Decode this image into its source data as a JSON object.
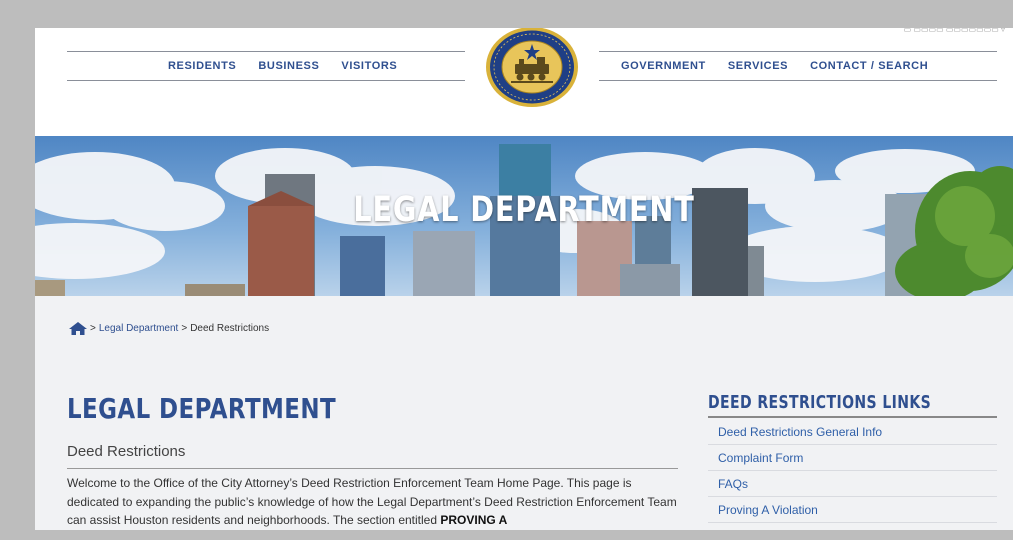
{
  "nav_left": [
    "RESIDENTS",
    "BUSINESS",
    "VISITORS"
  ],
  "nav_right": [
    "GOVERNMENT",
    "SERVICES",
    "CONTACT / SEARCH"
  ],
  "hero": {
    "title": "LEGAL DEPARTMENT"
  },
  "breadcrumb": {
    "sep1": ">",
    "link": "Legal Department",
    "sep2": ">",
    "current": "Deed Restrictions"
  },
  "main": {
    "heading": "LEGAL DEPARTMENT",
    "subheading": "Deed Restrictions",
    "intro_text": "Welcome to the Office of the City Attorney’s Deed Restriction Enforcement Team Home Page.  This page is dedicated to expanding the public’s knowledge of how the Legal Department’s Deed Restriction Enforcement Team can assist Houston residents and neighborhoods.  The section entitled ",
    "intro_bold": "PROVING A"
  },
  "sidebar": {
    "title": "DEED RESTRICTIONS LINKS",
    "links": [
      "Deed Restrictions General Info",
      "Complaint Form",
      "FAQs",
      "Proving A Violation"
    ]
  },
  "colors": {
    "brand_blue": "#2f4f8f",
    "link_blue": "#2f5fa8",
    "seal_gold": "#d9b23a",
    "seal_blue": "#1f3f85"
  },
  "icons": {
    "home": "home-icon",
    "seal": "city-seal-logo"
  }
}
